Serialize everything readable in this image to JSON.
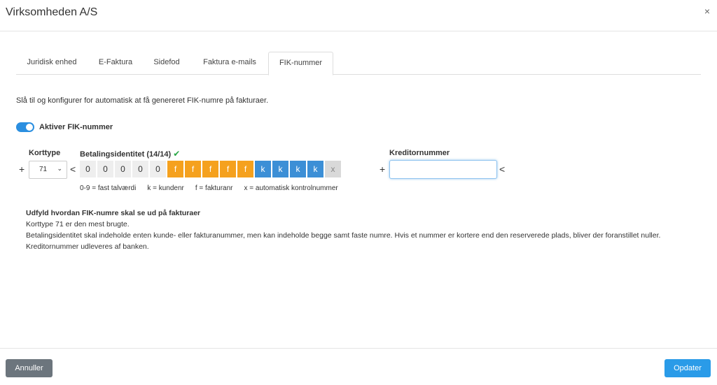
{
  "dialog": {
    "title": "Virksomheden A/S",
    "close_glyph": "×"
  },
  "tabs": [
    {
      "label": "Juridisk enhed",
      "active": false
    },
    {
      "label": "E-Faktura",
      "active": false
    },
    {
      "label": "Sidefod",
      "active": false
    },
    {
      "label": "Faktura e-mails",
      "active": false
    },
    {
      "label": "FIK-nummer",
      "active": true
    }
  ],
  "description": "Slå til og konfigurer for automatisk at få genereret FIK-numre på fakturaer.",
  "toggle": {
    "label": "Aktiver FIK-nummer",
    "on": true
  },
  "korttype": {
    "label": "Korttype",
    "value": "71",
    "plus": "+",
    "lt": "<"
  },
  "betaling": {
    "label": "Betalingsidentitet (14/14)",
    "check": "✔",
    "cells": [
      "0",
      "0",
      "0",
      "0",
      "0",
      "f",
      "f",
      "f",
      "f",
      "f",
      "k",
      "k",
      "k",
      "k",
      "x"
    ]
  },
  "legend": {
    "fixed": "0-9 = fast talværdi",
    "customer": "k = kundenr",
    "invoice": "f = fakturanr",
    "control": "x = automatisk kontrolnummer"
  },
  "kreditor": {
    "label": "Kreditornummer",
    "value": "",
    "plus": "+",
    "gt": "<"
  },
  "info": {
    "heading": "Udfyld hvordan FIK-numre skal se ud på fakturaer",
    "line1": "Korttype 71 er den mest brugte.",
    "line2": "Betalingsidentitet skal indeholde enten kunde- eller fakturanummer, men kan indeholde begge samt faste numre. Hvis et nummer er kortere end den reserverede plads, bliver der foranstillet nuller.",
    "line3": "Kreditornummer udleveres af banken."
  },
  "buttons": {
    "cancel": "Annuller",
    "update": "Opdater"
  },
  "colors": {
    "accent": "#2b8fe0",
    "invoice": "#f5a11e",
    "customer": "#3c8fd6",
    "fixed": "#eeeeee",
    "control": "#d9d9d9",
    "check": "#28a745"
  }
}
